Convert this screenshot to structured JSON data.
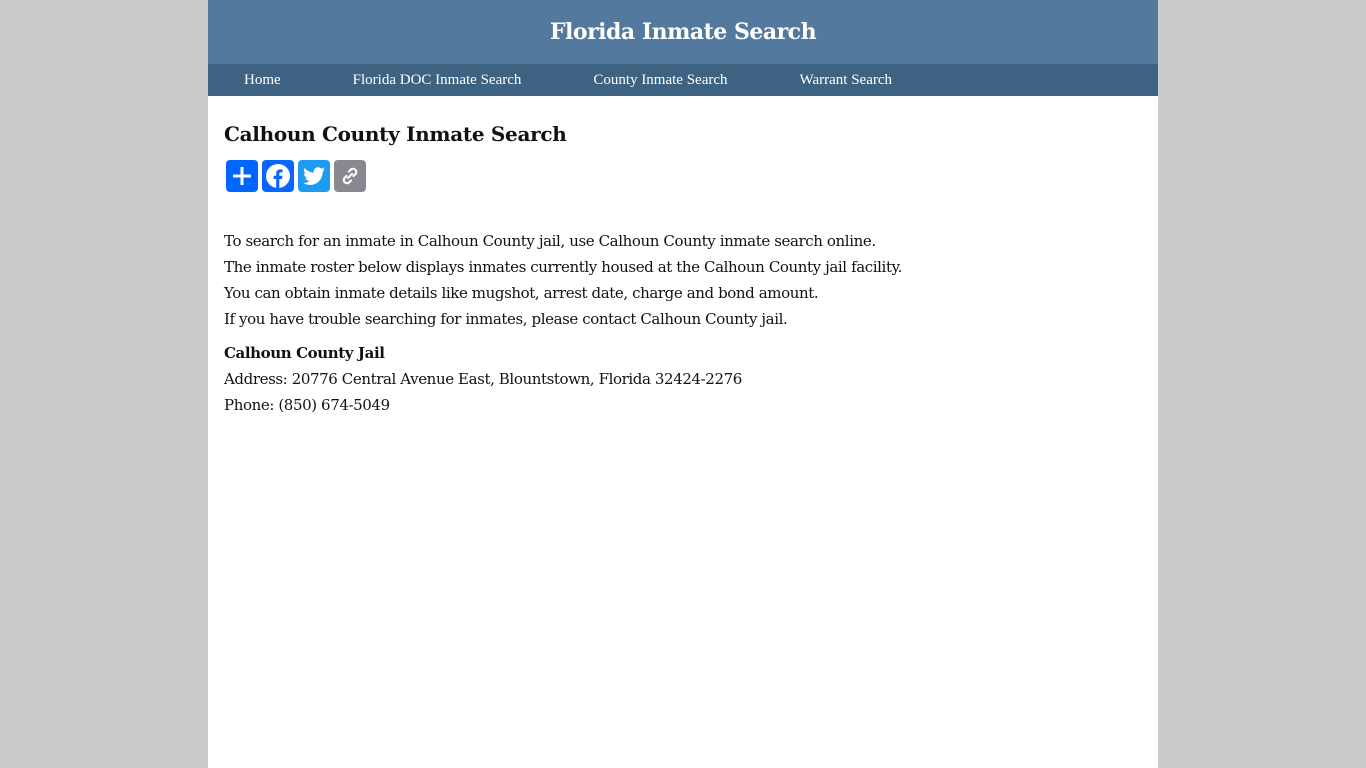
{
  "header": {
    "title": "Florida Inmate Search"
  },
  "nav": {
    "items": [
      {
        "label": "Home"
      },
      {
        "label": "Florida DOC Inmate Search"
      },
      {
        "label": "County Inmate Search"
      },
      {
        "label": "Warrant Search"
      }
    ]
  },
  "main": {
    "title": "Calhoun County Inmate Search",
    "share": [
      {
        "icon": "share-plus-icon",
        "color": "#0166ff"
      },
      {
        "icon": "facebook-icon",
        "color": "#0866ff"
      },
      {
        "icon": "twitter-icon",
        "color": "#1d9bf0"
      },
      {
        "icon": "copy-link-icon",
        "color": "#888990"
      }
    ],
    "intro": [
      "To search for an inmate in Calhoun County jail, use Calhoun County inmate search online.",
      "The inmate roster below displays inmates currently housed at the Calhoun County jail facility.",
      "You can obtain inmate details like mugshot, arrest date, charge and bond amount.",
      "If you have trouble searching for inmates, please contact Calhoun County jail."
    ],
    "jail": {
      "name": "Calhoun County Jail",
      "address": "Address: 20776 Central Avenue East, Blountstown, Florida 32424-2276",
      "phone": "Phone: (850) 674-5049"
    }
  }
}
